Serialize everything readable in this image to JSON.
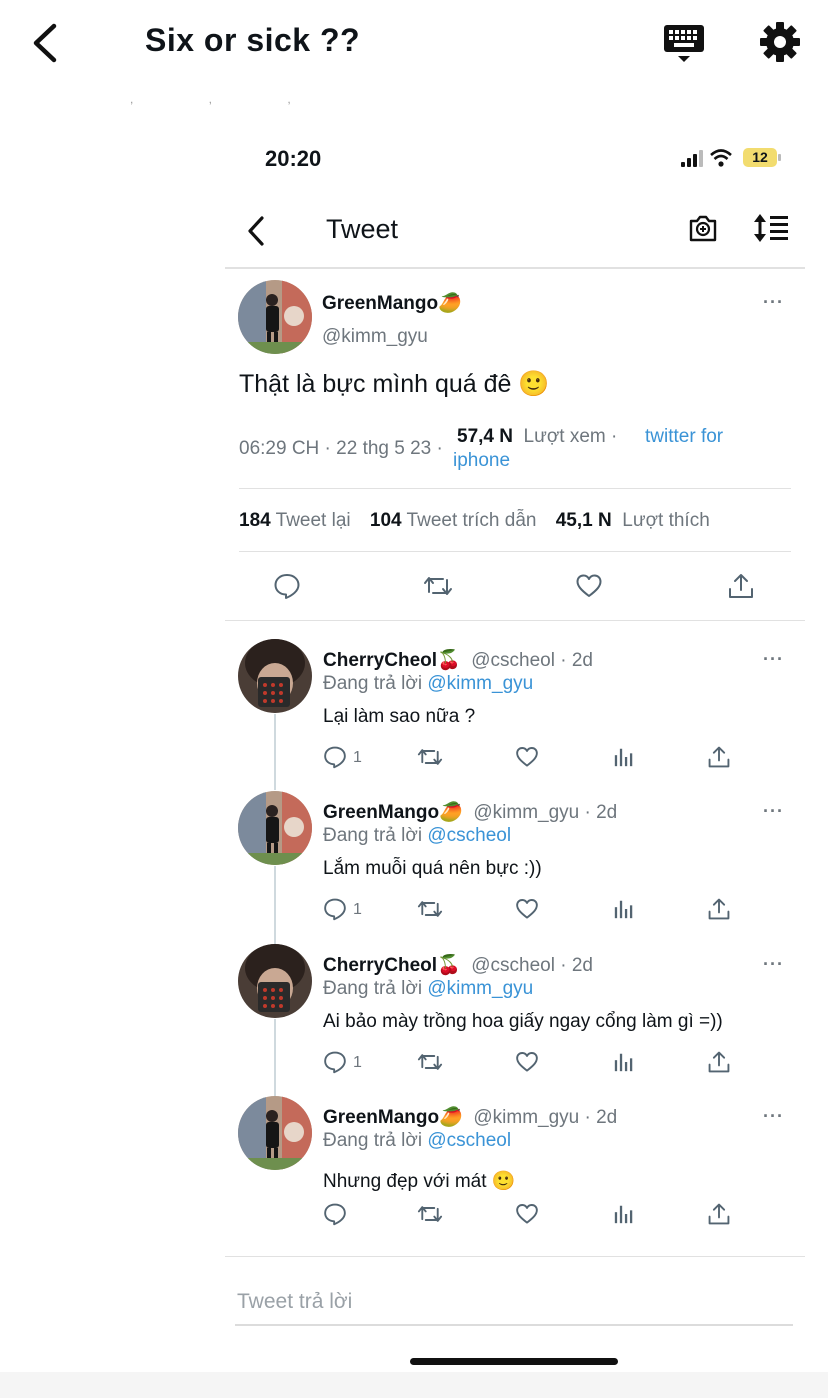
{
  "reader": {
    "title": "Six or sick ??",
    "back_icon": "chevron-left-icon",
    "keyboard_icon": "keyboard-icon",
    "settings_icon": "gear-icon"
  },
  "status_bar": {
    "time": "20:20",
    "battery": "12"
  },
  "nav": {
    "title": "Tweet"
  },
  "main_tweet": {
    "name": "GreenMango🥭",
    "handle": "@kimm_gyu",
    "more": "···",
    "text": "Thật là bực mình quá đê 🙂",
    "time": "06:29 CH · 22 thg 5 23 ·",
    "views_count": "57,4 N",
    "views_label": "Lượt xem ·",
    "source": "twitter for iphone",
    "retweets_count": "184",
    "retweets_label": "Tweet lại",
    "quotes_count": "104",
    "quotes_label": "Tweet trích dẫn",
    "likes_count": "45,1 N",
    "likes_label": "Lượt thích"
  },
  "replies": [
    {
      "name": "CherryCheol🍒",
      "handle_time": "@cscheol · 2d",
      "reply_prefix": "Đang trả lời",
      "reply_to": "@kimm_gyu",
      "text": "Lại làm sao nữa ?",
      "reply_count": "1",
      "more": "···"
    },
    {
      "name": "GreenMango🥭",
      "handle_time": "@kimm_gyu · 2d",
      "reply_prefix": "Đang trả lời",
      "reply_to": "@cscheol",
      "text": "Lắm muỗi quá nên bực :))",
      "reply_count": "1",
      "more": "···"
    },
    {
      "name": "CherryCheol🍒",
      "handle_time": "@cscheol · 2d",
      "reply_prefix": "Đang trả lời",
      "reply_to": "@kimm_gyu",
      "text": "Ai bảo mày trồng hoa giấy ngay cổng làm gì =))",
      "reply_count": "1",
      "more": "···"
    },
    {
      "name": "GreenMango🥭",
      "handle_time": "@kimm_gyu · 2d",
      "reply_prefix": "Đang trả lời",
      "reply_to": "@cscheol",
      "text": "Nhưng đẹp với mát 🙂",
      "reply_count": "",
      "more": "···"
    }
  ],
  "composer": {
    "placeholder": "Tweet trả lời"
  }
}
